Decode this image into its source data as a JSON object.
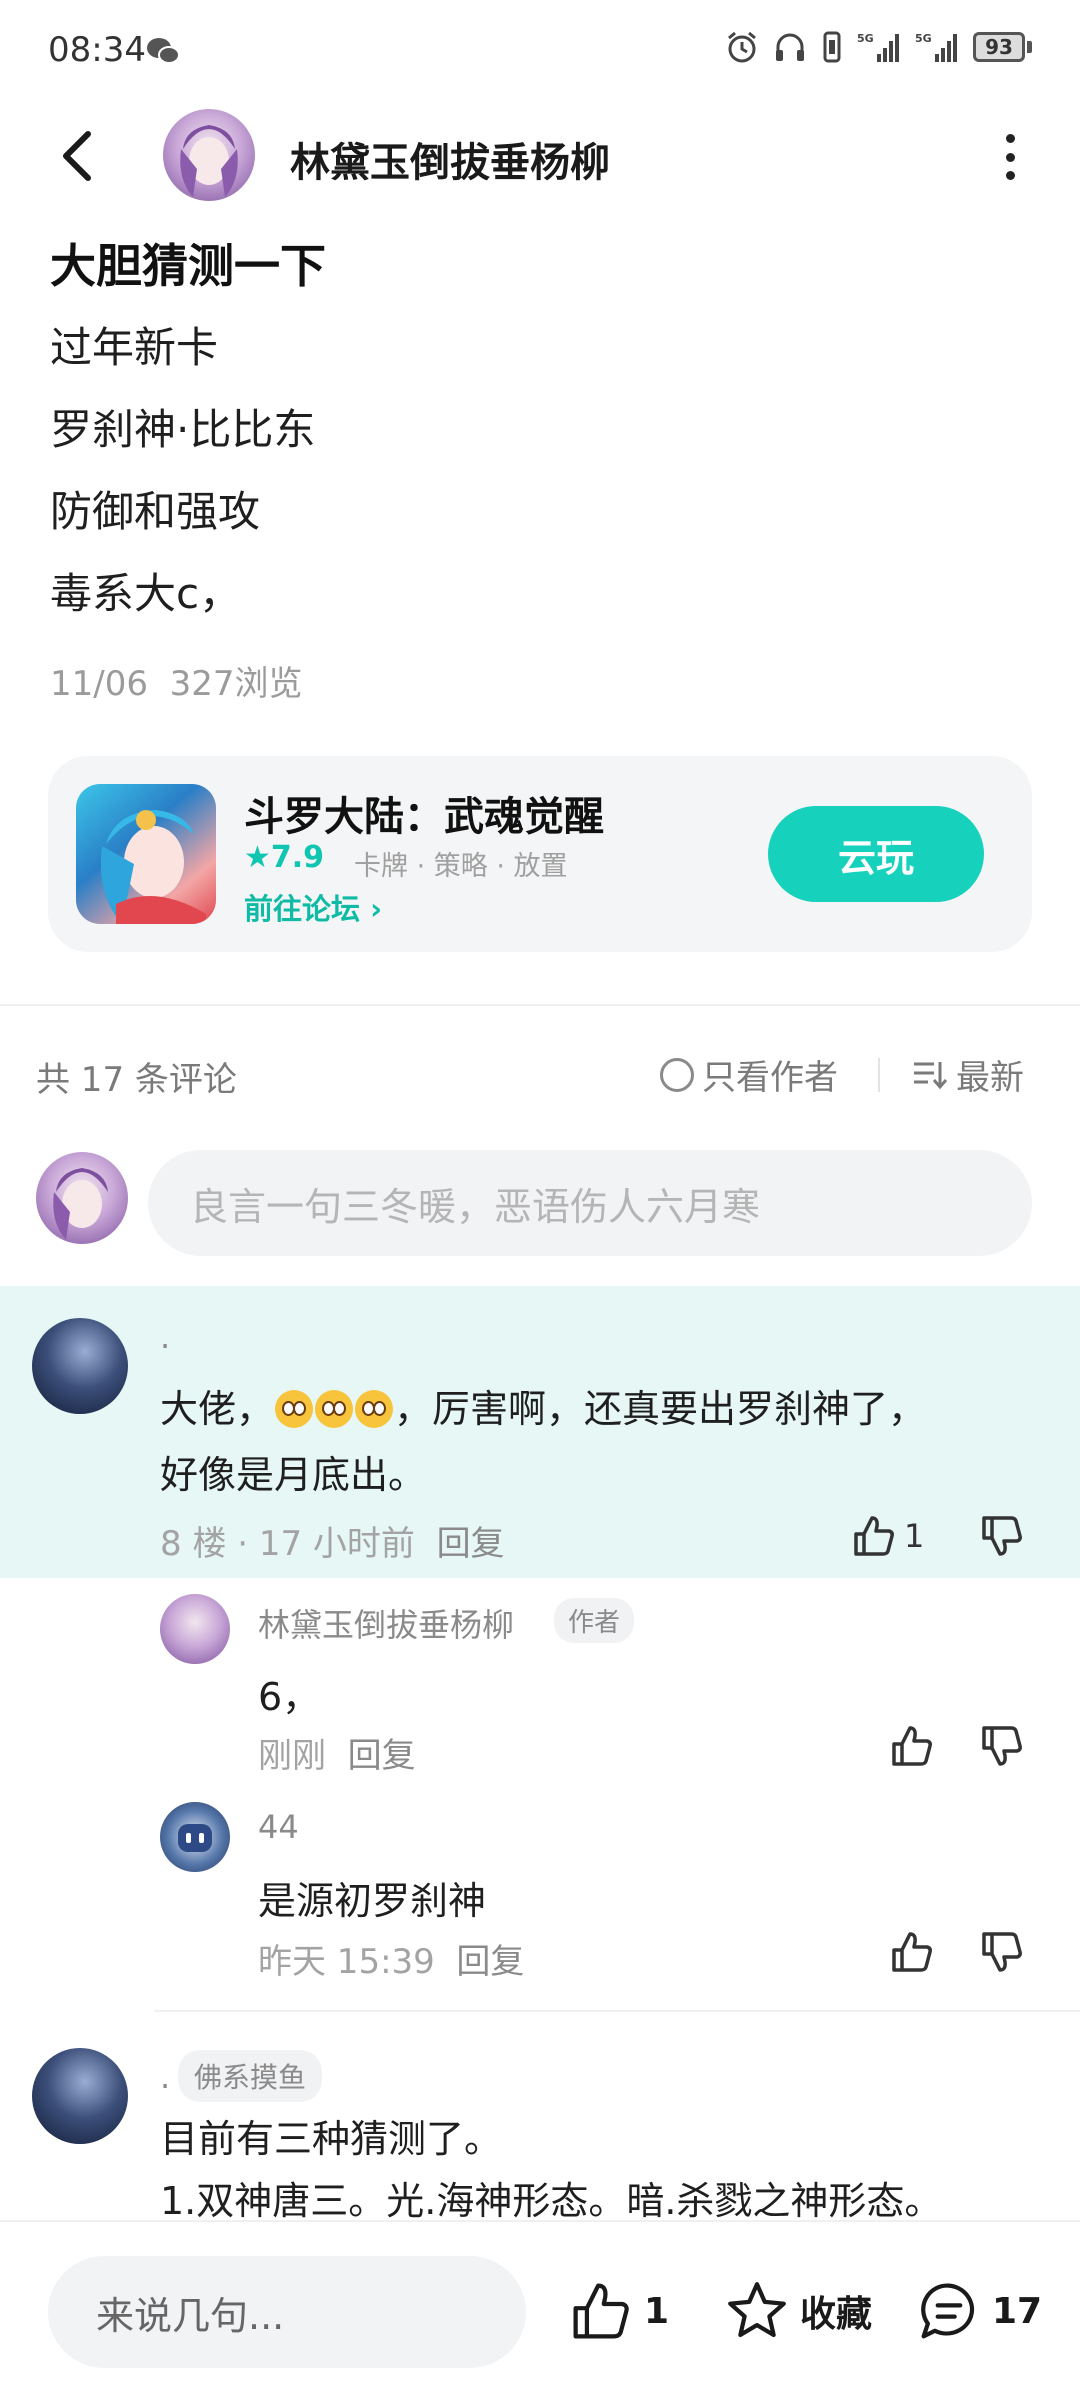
{
  "status_bar": {
    "time": "08:34",
    "battery": "93",
    "signal_1": "5G",
    "signal_2": "5G"
  },
  "header": {
    "author_name": "林黛玉倒拔垂杨柳"
  },
  "post": {
    "title": "大胆猜测一下",
    "lines": [
      "过年新卡",
      "罗刹神·比比东",
      "防御和强攻",
      "毒系大c，"
    ],
    "date": "11/06",
    "views": "327浏览"
  },
  "game_card": {
    "name": "斗罗大陆：武魂觉醒",
    "rating": "7.9",
    "tags": "卡牌 · 策略 · 放置",
    "forum_link": "前往论坛",
    "play_button": "云玩"
  },
  "comments_header": {
    "count": "共 17 条评论",
    "only_author": "只看作者",
    "sort": "最新"
  },
  "comment_input": {
    "placeholder": "良言一句三冬暖，恶语伤人六月寒"
  },
  "comments": [
    {
      "user": ".",
      "text_before_emoji": "大佬，",
      "text_after_emoji": "，厉害啊，还真要出罗刹神了，",
      "text_line2": "好像是月底出。",
      "meta": "8 楼 · 17 小时前",
      "reply": "回复",
      "likes": "1"
    },
    {
      "user": ".",
      "tag": "佛系摸鱼",
      "line1": "目前有三种猜测了。",
      "line2": "1.双神唐三。光.海神形态。暗.杀戮之神形态。"
    }
  ],
  "replies": [
    {
      "user": "林黛玉倒拔垂杨柳",
      "badge": "作者",
      "text": "6，",
      "time": "刚刚",
      "reply": "回复"
    },
    {
      "user": "44",
      "text": "是源初罗刹神",
      "time": "昨天 15:39",
      "reply": "回复"
    }
  ],
  "bottom_bar": {
    "input_placeholder": "来说几句...",
    "like_count": "1",
    "favorite": "收藏",
    "comment_count": "17"
  },
  "colors": {
    "accent": "#16d2bd",
    "highlight_bg": "#e6f7f5",
    "card_bg": "#f4f5f6"
  }
}
